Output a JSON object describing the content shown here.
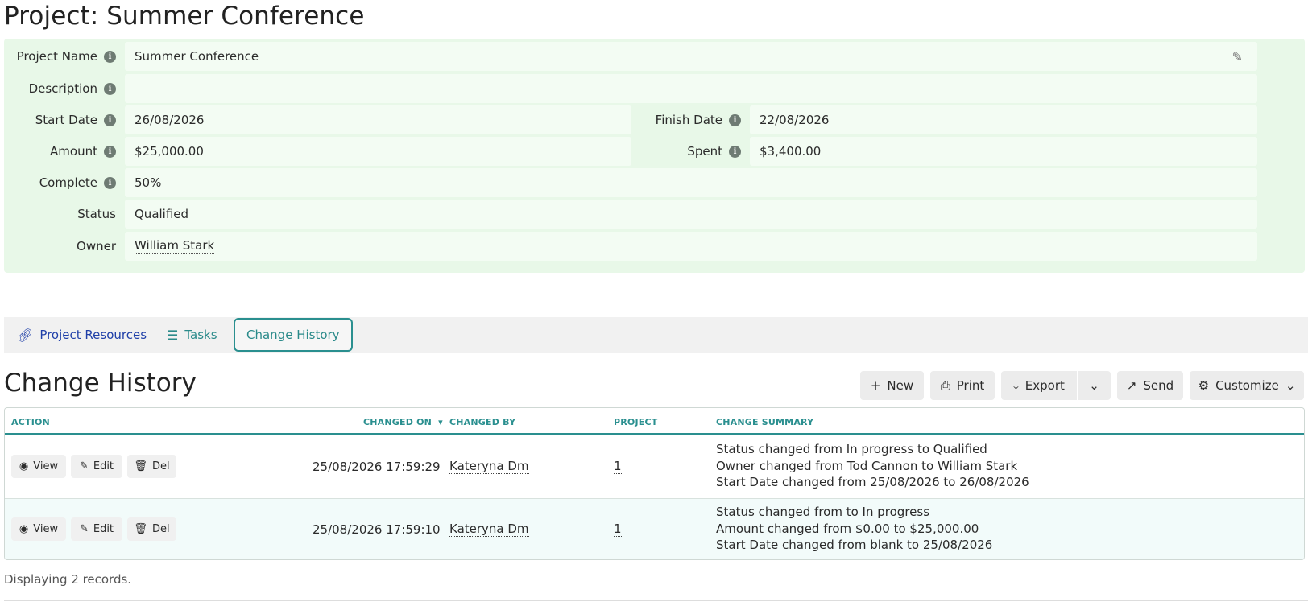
{
  "page_title": "Project: Summer Conference",
  "details": {
    "project_name_label": "Project Name",
    "project_name": "Summer Conference",
    "description_label": "Description",
    "description": "",
    "start_date_label": "Start Date",
    "start_date": "26/08/2026",
    "finish_date_label": "Finish Date",
    "finish_date": "22/08/2026",
    "amount_label": "Amount",
    "amount": "$25,000.00",
    "spent_label": "Spent",
    "spent": "$3,400.00",
    "complete_label": "Complete",
    "complete": "50%",
    "status_label": "Status",
    "status": "Qualified",
    "owner_label": "Owner",
    "owner": "William Stark",
    "info_glyph": "i"
  },
  "tabs": [
    {
      "label": "Project Resources",
      "icon": "link-icon"
    },
    {
      "label": "Tasks",
      "icon": "checklist-icon"
    },
    {
      "label": "Change History",
      "icon": ""
    }
  ],
  "section": {
    "title": "Change History"
  },
  "toolbar": {
    "new_label": "New",
    "print_label": "Print",
    "export_label": "Export",
    "send_label": "Send",
    "customize_label": "Customize"
  },
  "table": {
    "headers": [
      "ACTION",
      "CHANGED ON",
      "CHANGED BY",
      "PROJECT",
      "CHANGE SUMMARY"
    ],
    "row_buttons": {
      "view": "View",
      "edit": "Edit",
      "del": "Del"
    },
    "rows": [
      {
        "changed_on": "25/08/2026 17:59:29",
        "changed_by": "Kateryna Dm",
        "project": "1",
        "summary": [
          "Status changed from In progress to Qualified",
          "Owner changed from Tod Cannon to William Stark",
          "Start Date changed from 25/08/2026 to 26/08/2026"
        ]
      },
      {
        "changed_on": "25/08/2026 17:59:10",
        "changed_by": "Kateryna Dm",
        "project": "1",
        "summary": [
          "Status changed from to In progress",
          "Amount changed from $0.00 to $25,000.00",
          "Start Date changed from blank to 25/08/2026"
        ]
      }
    ]
  },
  "footer": {
    "text": "Displaying 2 records."
  },
  "colors": {
    "panel_bg": "#e8f8e8",
    "accent_teal": "#2a8f8f",
    "link_blue": "#1f3fa8"
  }
}
